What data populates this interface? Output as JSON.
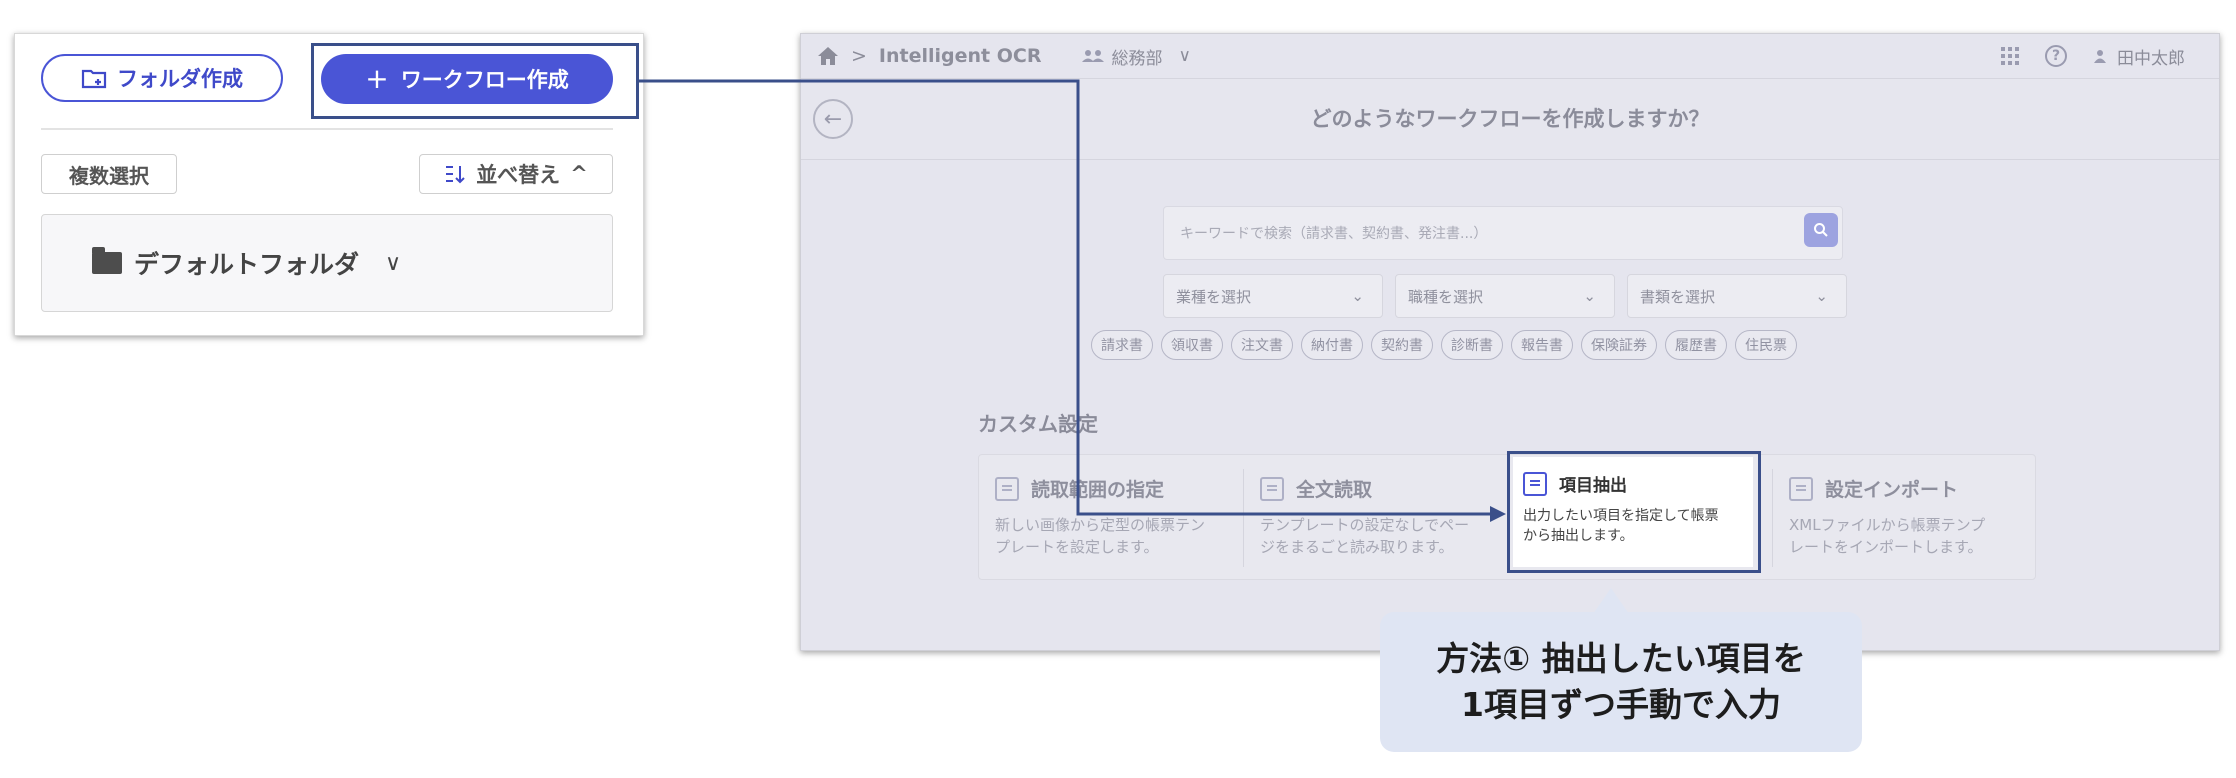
{
  "left_panel": {
    "folder_button": "フォルダ作成",
    "workflow_button": "ワークフロー作成",
    "workflow_plus": "+",
    "multi_select": "複数選択",
    "sort_button": "並べ替え",
    "sort_chevron": "^",
    "folder_name": "デフォルトフォルダ",
    "folder_chevron": "∨"
  },
  "app": {
    "breadcrumb_sep": ">",
    "app_name": "Intelligent OCR",
    "department": "総務部",
    "department_chevron": "∨",
    "user_name": "田中太郎",
    "help_glyph": "?",
    "page_title": "どのようなワークフローを作成しますか？",
    "search_placeholder": "キーワードで検索（請求書、契約書、発注書...）",
    "selects": [
      {
        "label": "業種を選択"
      },
      {
        "label": "職種を選択"
      },
      {
        "label": "書類を選択"
      }
    ],
    "chips": [
      "請求書",
      "領収書",
      "注文書",
      "納付書",
      "契約書",
      "診断書",
      "報告書",
      "保険証券",
      "履歴書",
      "住民票"
    ],
    "custom_title": "カスタム設定",
    "cards": [
      {
        "title": "読取範囲の指定",
        "desc1": "新しい画像から定型の帳票テン",
        "desc2": "プレートを設定します。"
      },
      {
        "title": "全文読取",
        "desc1": "テンプレートの設定なしでペー",
        "desc2": "ジをまるごと読み取ります。"
      },
      {
        "title": "項目抽出",
        "desc1": "出力したい項目を指定して帳票",
        "desc2": "から抽出します。"
      },
      {
        "title": "設定インポート",
        "desc1": "XMLファイルから帳票テンプ",
        "desc2": "レートをインポートします。"
      }
    ]
  },
  "callout": {
    "line1": "方法① 抽出したい項目を",
    "line2": "1項目ずつ手動で入力"
  },
  "colors": {
    "accent": "#4a55d6",
    "highlight_frame": "#3a4f8a",
    "callout_bg": "#dfe5f3"
  }
}
